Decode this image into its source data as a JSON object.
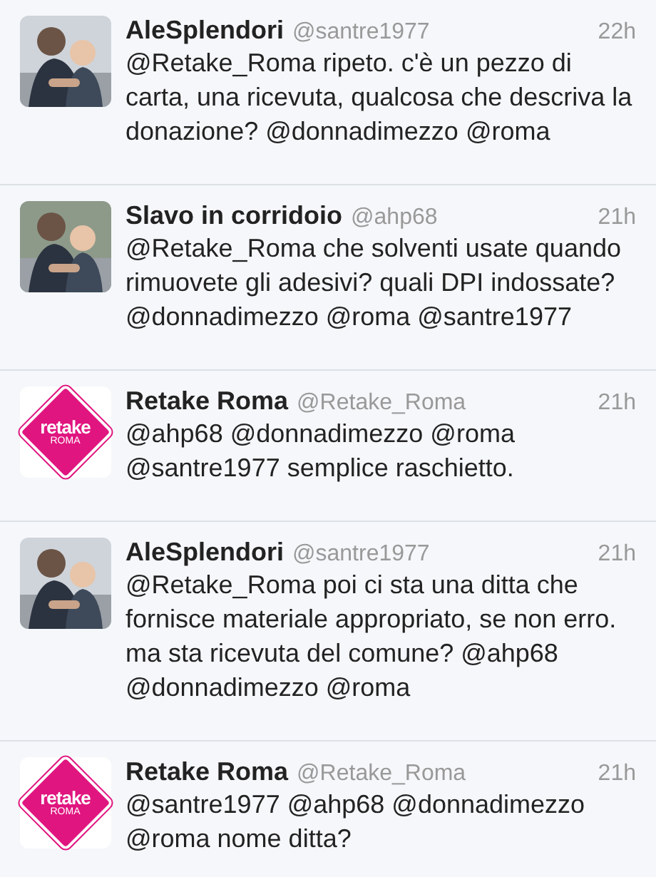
{
  "tweets": [
    {
      "name": "AleSplendori",
      "handle": "@santre1977",
      "time": "22h",
      "text": "@Retake_Roma ripeto. c'è un pezzo di carta, una ricevuta, qualcosa che descriva la donazione? @donnadimezzo @roma"
    },
    {
      "name": "Slavo in corridoio",
      "handle": "@ahp68",
      "time": "21h",
      "text": "@Retake_Roma che solventi usate quando rimuovete gli adesivi? quali DPI indossate? @donnadimezzo @roma @santre1977"
    },
    {
      "name": "Retake Roma",
      "handle": "@Retake_Roma",
      "time": "21h",
      "avatar": {
        "kind": "logo",
        "logo_text": [
          "retake",
          "ROMA"
        ]
      },
      "text": "@ahp68 @donnadimezzo @roma @santre1977 semplice raschietto."
    },
    {
      "name": "AleSplendori",
      "handle": "@santre1977",
      "time": "21h",
      "text": "@Retake_Roma poi ci sta una ditta che fornisce materiale appropriato, se non erro. ma sta ricevuta del comune? @ahp68 @donnadimezzo @roma"
    },
    {
      "name": "Retake Roma",
      "handle": "@Retake_Roma",
      "time": "21h",
      "avatar": {
        "kind": "logo",
        "logo_text": [
          "retake",
          "ROMA"
        ]
      },
      "text": "@santre1977 @ahp68 @donnadimezzo @roma nome ditta?"
    }
  ]
}
